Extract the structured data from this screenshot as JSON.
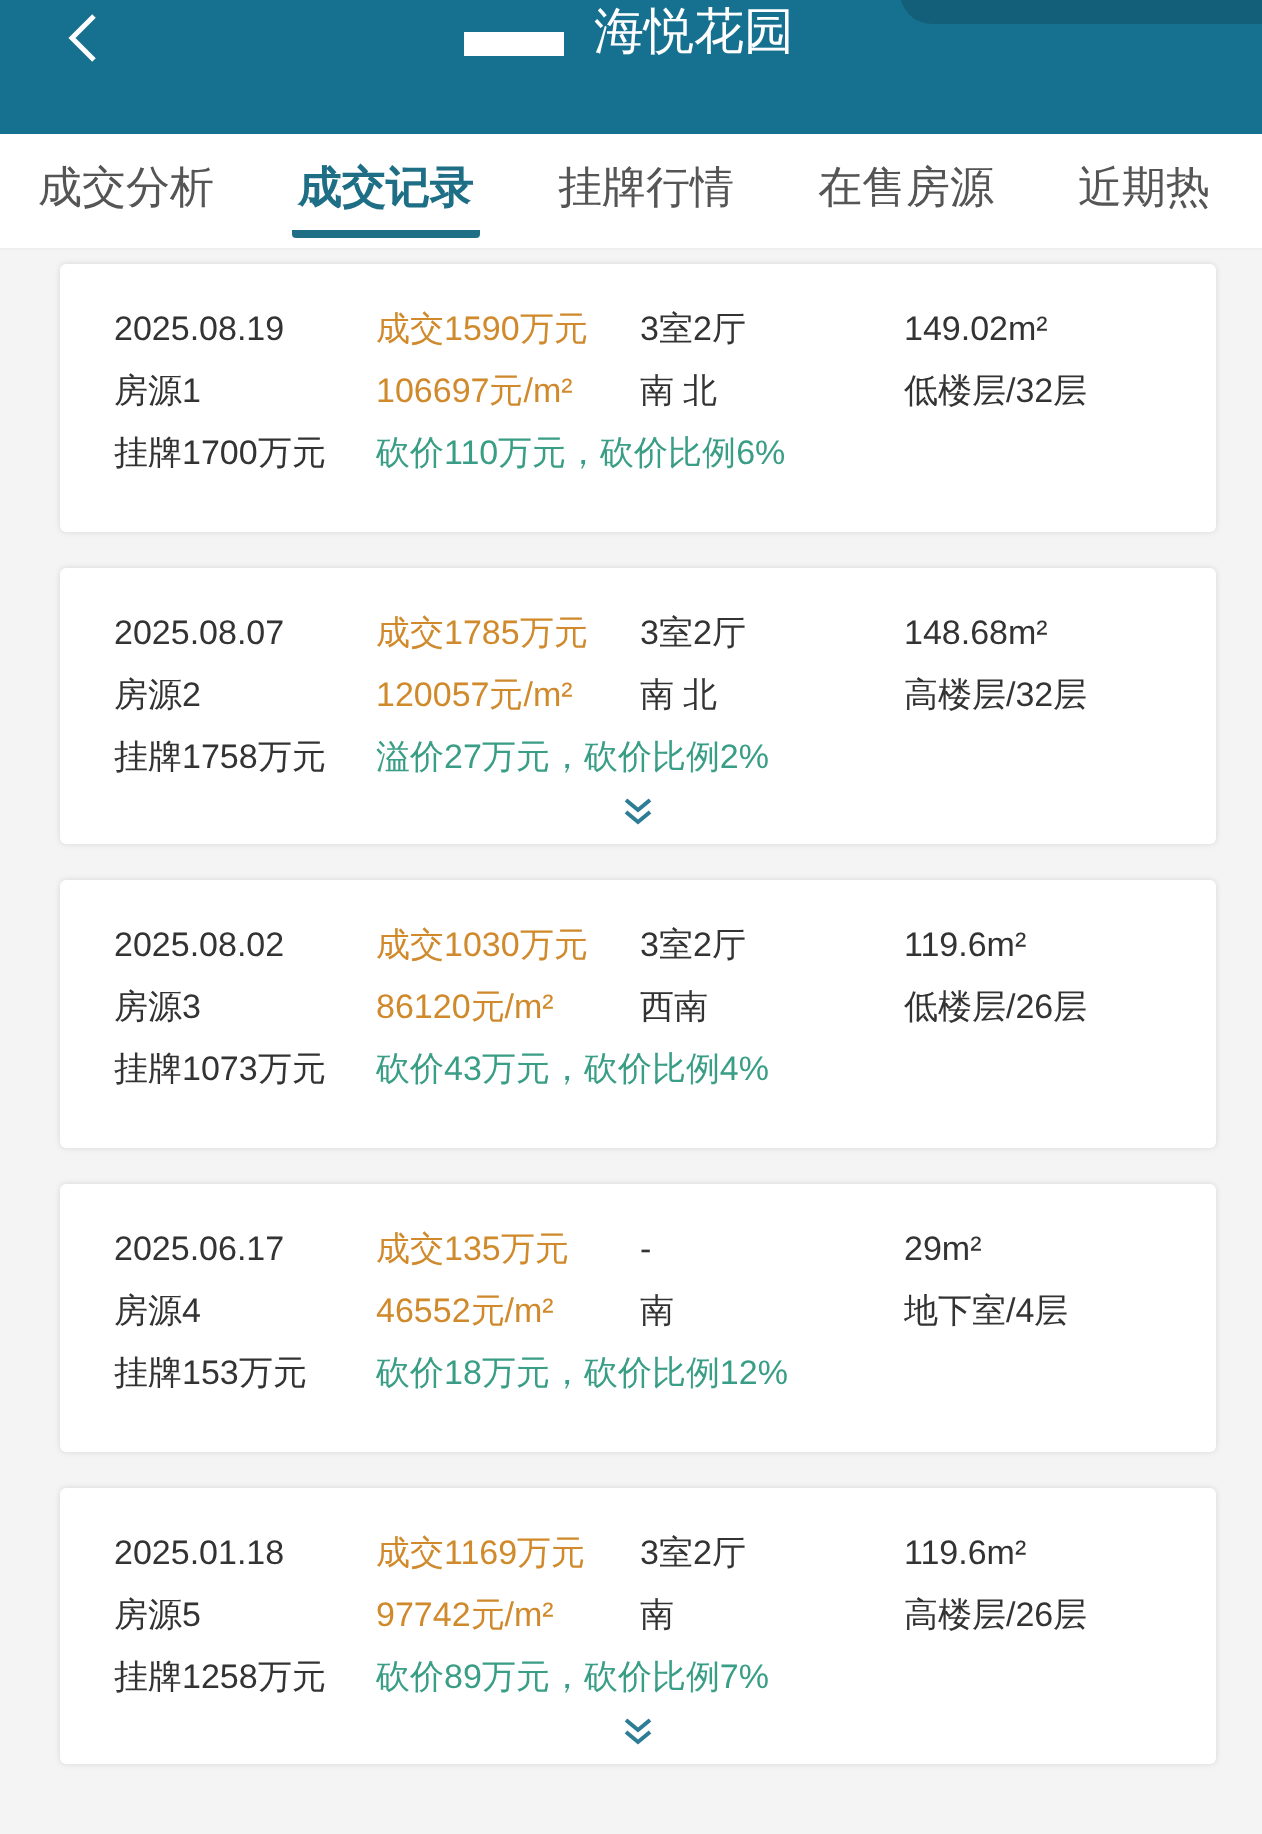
{
  "header": {
    "title": "海悦花园"
  },
  "tabs": [
    {
      "label": "成交分析",
      "selected": false
    },
    {
      "label": "成交记录",
      "selected": true
    },
    {
      "label": "挂牌行情",
      "selected": false
    },
    {
      "label": "在售房源",
      "selected": false
    },
    {
      "label": "近期热",
      "selected": false
    }
  ],
  "records": [
    {
      "date": "2025.08.19",
      "deal_price": "成交1590万元",
      "layout": "3室2厅",
      "area": "149.02m²",
      "listing": "房源1",
      "unit_price": "106697元/m²",
      "orientation": "南 北",
      "floor": "低楼层/32层",
      "list_price": "挂牌1700万元",
      "discount": "砍价110万元，砍价比例6%",
      "expandable": false
    },
    {
      "date": "2025.08.07",
      "deal_price": "成交1785万元",
      "layout": "3室2厅",
      "area": "148.68m²",
      "listing": "房源2",
      "unit_price": "120057元/m²",
      "orientation": "南 北",
      "floor": "高楼层/32层",
      "list_price": "挂牌1758万元",
      "discount": "溢价27万元，砍价比例2%",
      "expandable": true
    },
    {
      "date": "2025.08.02",
      "deal_price": "成交1030万元",
      "layout": "3室2厅",
      "area": "119.6m²",
      "listing": "房源3",
      "unit_price": "86120元/m²",
      "orientation": "西南",
      "floor": "低楼层/26层",
      "list_price": "挂牌1073万元",
      "discount": "砍价43万元，砍价比例4%",
      "expandable": false
    },
    {
      "date": "2025.06.17",
      "deal_price": "成交135万元",
      "layout": "-",
      "area": "29m²",
      "listing": "房源4",
      "unit_price": "46552元/m²",
      "orientation": "南",
      "floor": "地下室/4层",
      "list_price": "挂牌153万元",
      "discount": "砍价18万元，砍价比例12%",
      "expandable": false
    },
    {
      "date": "2025.01.18",
      "deal_price": "成交1169万元",
      "layout": "3室2厅",
      "area": "119.6m²",
      "listing": "房源5",
      "unit_price": "97742元/m²",
      "orientation": "南",
      "floor": "高楼层/26层",
      "list_price": "挂牌1258万元",
      "discount": "砍价89万元，砍价比例7%",
      "expandable": true
    }
  ]
}
